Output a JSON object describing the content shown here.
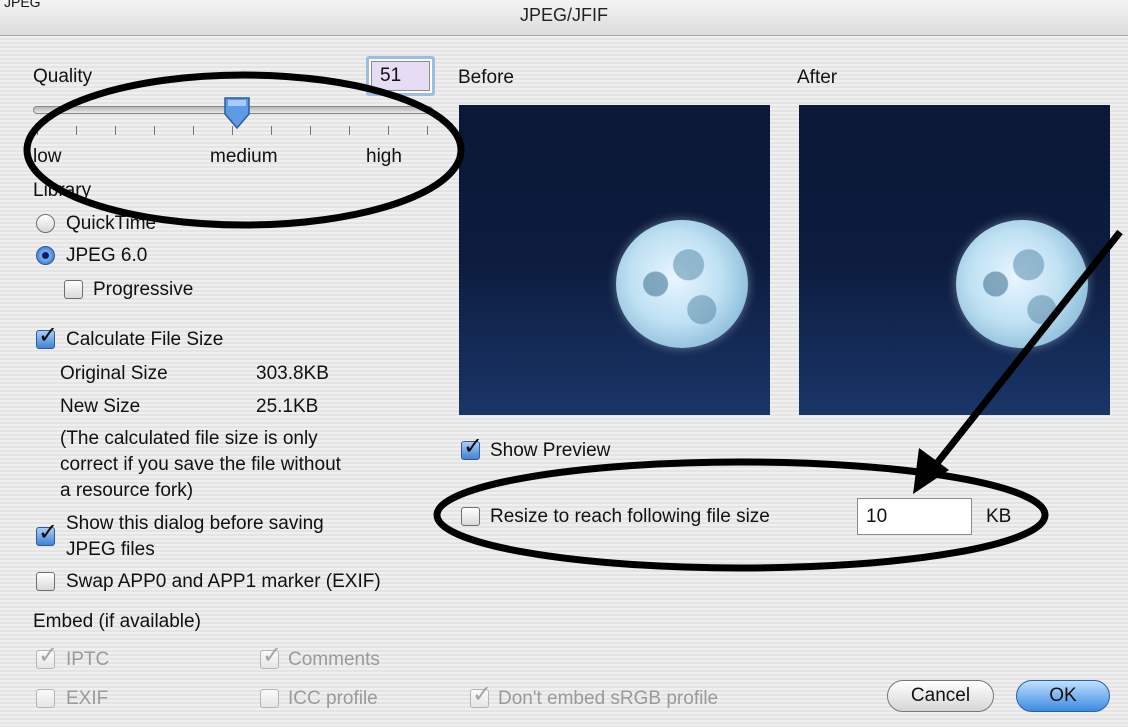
{
  "window": {
    "title": "JPEG/JFIF",
    "corner_label": "JPEG"
  },
  "quality": {
    "label": "Quality",
    "value": "51",
    "slider_fraction": 0.51,
    "labels": {
      "low": "low",
      "medium": "medium",
      "high": "high"
    }
  },
  "library": {
    "label": "Library",
    "options": [
      "QuickTime",
      "JPEG 6.0"
    ],
    "selected": "JPEG 6.0",
    "progressive_label": "Progressive",
    "progressive_checked": false
  },
  "file_size": {
    "calc_label": "Calculate File Size",
    "calc_checked": true,
    "original_label": "Original Size",
    "original_value": "303.8KB",
    "new_label": "New Size",
    "new_value": "25.1KB",
    "note_lines": [
      "(The calculated file size is only",
      "correct if you save the file without",
      "a resource fork)"
    ]
  },
  "show_dialog": {
    "label_lines": [
      "Show this dialog before saving",
      "JPEG files"
    ],
    "checked": true
  },
  "swap_marker": {
    "label": "Swap APP0 and APP1 marker (EXIF)",
    "checked": false
  },
  "embed": {
    "label": "Embed (if available)",
    "iptc": {
      "label": "IPTC",
      "checked": true
    },
    "comments": {
      "label": "Comments",
      "checked": true
    },
    "exif": {
      "label": "EXIF",
      "checked": false
    },
    "icc": {
      "label": "ICC profile",
      "checked": false
    },
    "srgb": {
      "label": "Don't embed sRGB profile",
      "checked": true
    }
  },
  "preview": {
    "before_label": "Before",
    "after_label": "After",
    "show_label": "Show Preview",
    "show_checked": true
  },
  "resize": {
    "label": "Resize to reach following file size",
    "checked": false,
    "value": "10",
    "unit": "KB"
  },
  "buttons": {
    "cancel": "Cancel",
    "ok": "OK"
  },
  "colors": {
    "accent": "#3d8ae3",
    "quality_field_bg": "#e6dcf4",
    "sky": "#0b1836",
    "moon": "#bfe1f3"
  }
}
